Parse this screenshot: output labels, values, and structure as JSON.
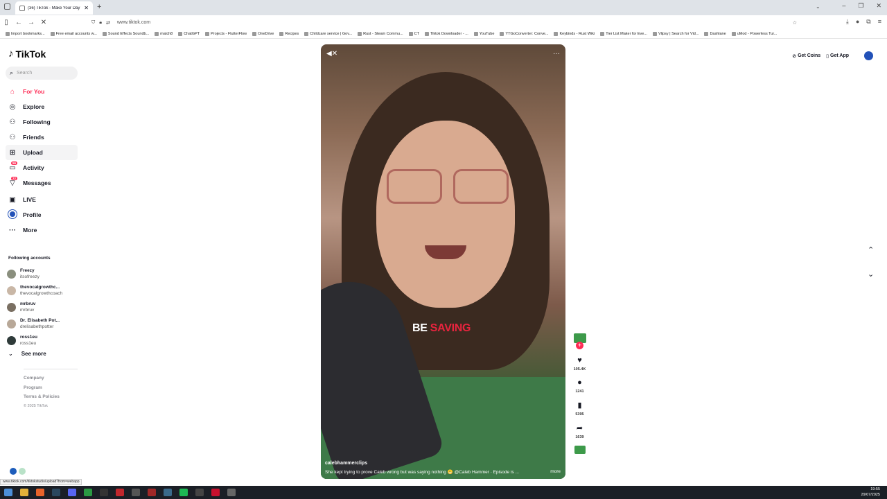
{
  "browser": {
    "tab_title": "(36) TikTok - Make Your Day",
    "new_tab": "+",
    "url": "www.tiktok.com",
    "back": "←",
    "forward": "→",
    "bookmarks": [
      "Import bookmarks...",
      "Free email accounts w...",
      "Sound Effects Soundb...",
      "match8",
      "ChatGPT",
      "Projects - FlutterFlow",
      "OneDrive",
      "Recipes",
      "Childcare service | Gov...",
      "Rust - Steam Commu...",
      "CT",
      "Tiktok Downloader - ...",
      "YouTube",
      "YTGoConverter: Conve...",
      "Keybinds - Rust Wiki",
      "Tier List Maker for Eve...",
      "Vlipsy | Search for Vid...",
      "Dashlane",
      "uMod - Powerless Tur..."
    ]
  },
  "sidebar": {
    "logo": "TikTok",
    "search_placeholder": "Search",
    "items": [
      {
        "label": "For You",
        "icon": "home-icon",
        "glyph": "⌂"
      },
      {
        "label": "Explore",
        "icon": "compass-icon",
        "glyph": "◎"
      },
      {
        "label": "Following",
        "icon": "following-icon",
        "glyph": "⚇"
      },
      {
        "label": "Friends",
        "icon": "friends-icon",
        "glyph": "⚇"
      },
      {
        "label": "Upload",
        "icon": "upload-icon",
        "glyph": "⊞"
      },
      {
        "label": "Activity",
        "icon": "activity-icon",
        "glyph": "▭",
        "badge": "56"
      },
      {
        "label": "Messages",
        "icon": "messages-icon",
        "glyph": "▽",
        "badge": "22"
      },
      {
        "label": "LIVE",
        "icon": "live-icon",
        "glyph": "▣"
      },
      {
        "label": "Profile",
        "icon": "profile-avatar-icon",
        "glyph": ""
      },
      {
        "label": "More",
        "icon": "more-icon",
        "glyph": "···"
      }
    ],
    "following_title": "Following accounts",
    "following": [
      {
        "name": "Freezy",
        "user": "itsofreezy"
      },
      {
        "name": "thevocalgrowthc...",
        "user": "thevocalgrowthcoach"
      },
      {
        "name": "mrbruv",
        "user": "mrbruv"
      },
      {
        "name": "Dr. Elisabeth Pot...",
        "user": "drelisabethpotter"
      },
      {
        "name": "ross1eu",
        "user": "ross1eu"
      }
    ],
    "see_more": "See more",
    "footer": {
      "company": "Company",
      "program": "Program",
      "terms": "Terms & Policies",
      "copyright": "© 2025 TikTok"
    }
  },
  "topbar": {
    "get_coins": "Get Coins",
    "get_app": "Get App"
  },
  "video": {
    "caption_word_1": "BE",
    "caption_word_2": "SAVING",
    "author": "calebhammerclips",
    "description": "She kept trying to prove Caleb wrong but was saying nothing 😬 @Caleb Hammer · Episode is ...",
    "more": "more"
  },
  "actions": {
    "likes": "105.4K",
    "comments": "1241",
    "saves": "5395",
    "shares": "1639"
  },
  "status_url": "www.tiktok.com/tiktokstudio/upload?from=webapp",
  "clock": {
    "time": "19:55",
    "date": "29/07/2025"
  },
  "colors": {
    "accent": "#fe2c55",
    "text": "#161823"
  }
}
